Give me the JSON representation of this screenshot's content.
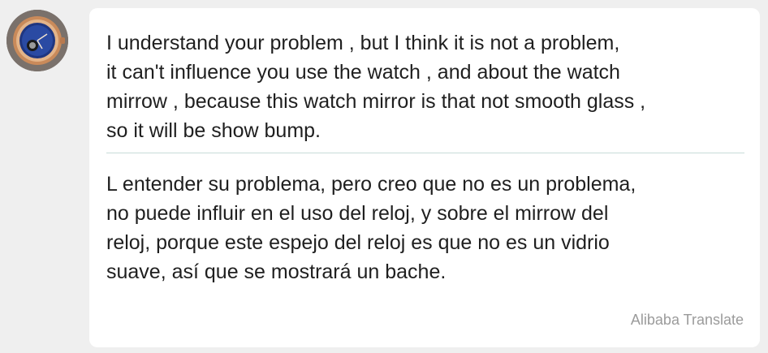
{
  "chat": {
    "avatar_icon": "watch-icon",
    "message": {
      "original_text": "I understand your problem , but I think it is not a problem,\nit can't influence you use the watch , and about the  watch\nmirrow , because this watch mirror is that not smooth glass ,\nso it will be show bump.",
      "translated_text": "L entender su problema, pero creo que no es un problema,\nno puede influir en el uso del reloj, y sobre el mirrow del\nreloj, porque este espejo del reloj es que no es un vidrio\nsuave, así que se mostrará un bache.",
      "translation_credit": "Alibaba Translate"
    }
  },
  "colors": {
    "background": "#efefef",
    "bubble": "#ffffff",
    "divider": "#c8dcd8",
    "text": "#1f1f1f",
    "credit": "#9b9b9b"
  }
}
